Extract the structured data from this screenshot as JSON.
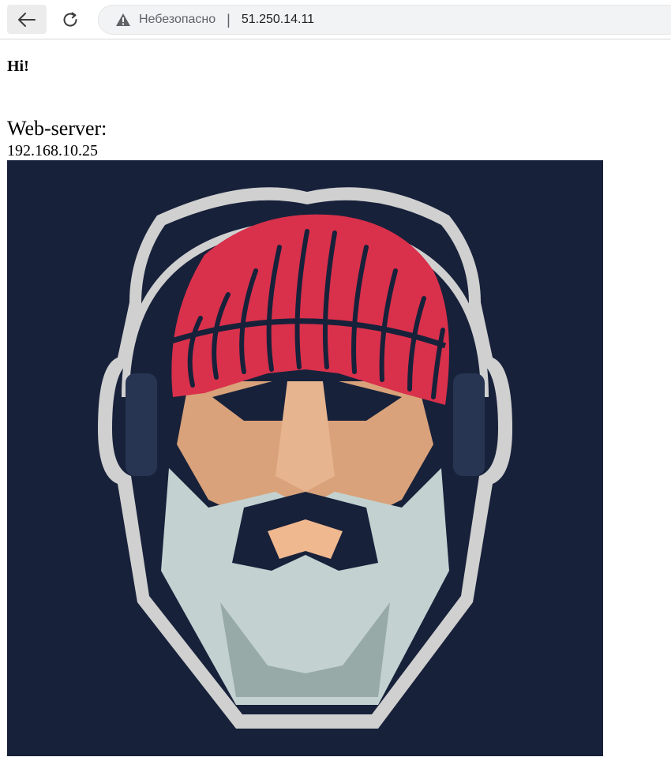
{
  "browser": {
    "security_label": "Небезопасно",
    "url": "51.250.14.11"
  },
  "page": {
    "greeting": "Hi!",
    "server_title": "Web-server:",
    "server_ip": "192.168.10.25"
  },
  "image": {
    "icon": "bearded-man-headphones-logo",
    "colors": {
      "background": "#17213a",
      "hat": "#d9304b",
      "skin": "#d9a27a",
      "beard": "#c3d2d1",
      "outline": "#d0d0d0"
    }
  }
}
